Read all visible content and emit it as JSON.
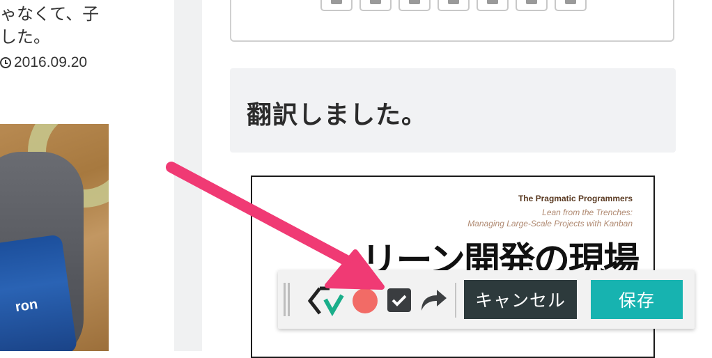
{
  "left": {
    "text_line1": "ゃなくて、子",
    "text_line2": "した。",
    "date": "2016.09.20",
    "photo_caption": "ron"
  },
  "heading": "翻訳しました。",
  "book": {
    "publisher": "The Pragmatic Programmers",
    "subtitle_line1": "Lean from the Trenches:",
    "subtitle_line2": "Managing Large-Scale Projects with Kanban",
    "title": "リーン開発の現場"
  },
  "toolbar": {
    "cancel_label": "キャンセル",
    "save_label": "保存"
  },
  "colors": {
    "accent_save": "#17b3b0",
    "cancel_bg": "#2d3a3c",
    "record_dot": "#f26b66",
    "annotation_arrow": "#f03a74",
    "heading_bg": "#f1f2f4"
  },
  "icons": [
    "clock-icon",
    "share-icon",
    "logo-icon",
    "record-icon",
    "check-icon",
    "redo-icon",
    "drag-handle-icon",
    "annotation-arrow"
  ]
}
